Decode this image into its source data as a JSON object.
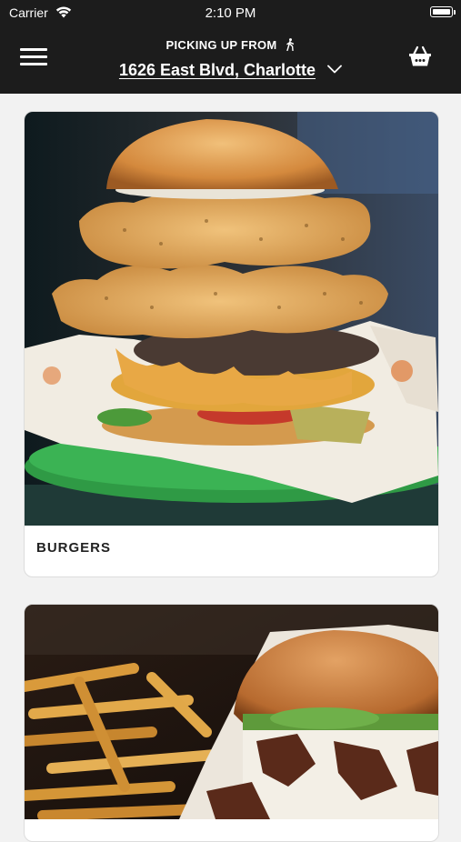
{
  "status_bar": {
    "carrier": "Carrier",
    "time": "2:10 PM"
  },
  "header": {
    "pickup_label": "PICKING UP FROM",
    "address": "1626 East Blvd, Charlotte",
    "icons": [
      "menu-icon",
      "walking-person-icon",
      "chevron-down-icon",
      "basket-icon"
    ]
  },
  "categories": [
    {
      "title": "BURGERS",
      "image": "stacked burger with fried onion rings"
    },
    {
      "title": "",
      "image": "bacon burger with fries"
    }
  ],
  "colors": {
    "header_bg": "#1c1c1c",
    "page_bg": "#f2f2f2",
    "card_bg": "#ffffff"
  }
}
